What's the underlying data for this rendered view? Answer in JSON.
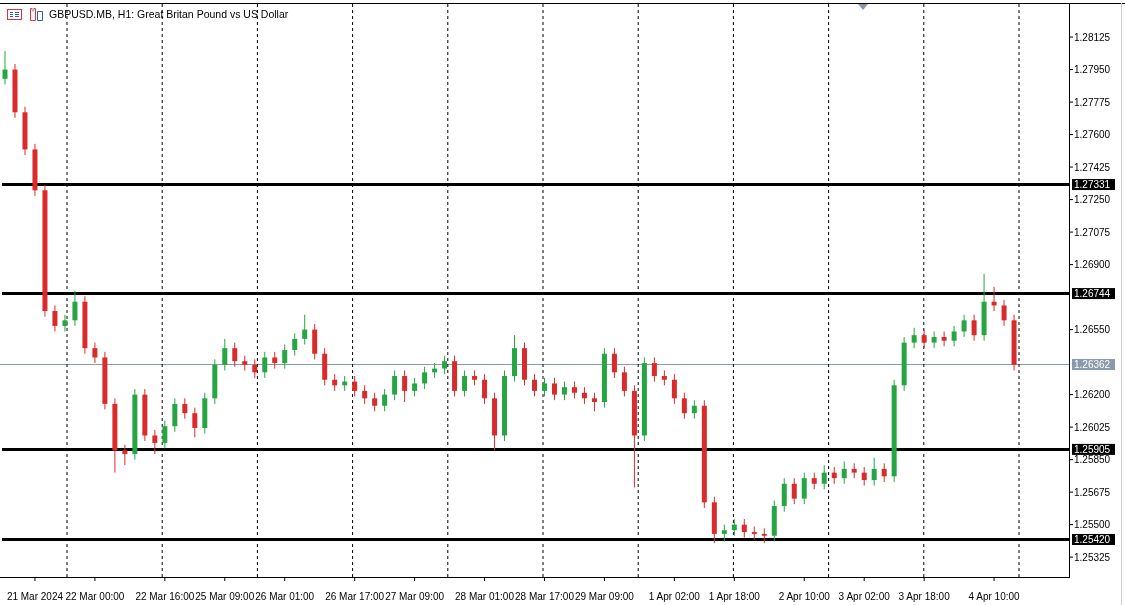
{
  "title": "GBPUSD.MB, H1:  Great Britan Pound vs US Dollar",
  "chart_data": {
    "type": "candlestick",
    "categories": [
      null,
      null,
      null,
      "21 Mar 2024",
      null,
      null,
      null,
      null,
      null,
      "22 Mar 00:00",
      null,
      null,
      null,
      null,
      null,
      null,
      "22 Mar 16:00",
      null,
      null,
      null,
      null,
      null,
      "25 Mar 09:00",
      null,
      null,
      null,
      null,
      null,
      "26 Mar 01:00",
      null,
      null,
      null,
      null,
      null,
      null,
      "26 Mar 17:00",
      null,
      null,
      null,
      null,
      null,
      "27 Mar 09:00",
      null,
      null,
      null,
      null,
      null,
      null,
      "28 Mar 01:00",
      null,
      null,
      null,
      null,
      null,
      "28 Mar 17:00",
      null,
      null,
      null,
      null,
      null,
      "29 Mar 09:00",
      null,
      null,
      null,
      null,
      null,
      null,
      "1 Apr 02:00",
      null,
      null,
      null,
      null,
      null,
      "1 Apr 18:00",
      null,
      null,
      null,
      null,
      null,
      null,
      "2 Apr 10:00",
      null,
      null,
      null,
      null,
      null,
      "3 Apr 02:00",
      null,
      null,
      null,
      null,
      null,
      "3 Apr 18:00",
      null,
      null,
      null,
      null,
      null,
      null,
      "4 Apr 10:00",
      null,
      null,
      null,
      null,
      null,
      null,
      null
    ],
    "ohlc": [
      [
        1.279,
        1.2805,
        1.2787,
        1.2795
      ],
      [
        1.2795,
        1.2798,
        1.2769,
        1.2772
      ],
      [
        1.2772,
        1.2775,
        1.2749,
        1.2752
      ],
      [
        1.2752,
        1.2755,
        1.2727,
        1.273
      ],
      [
        1.273,
        1.2733,
        1.2662,
        1.2665
      ],
      [
        1.2665,
        1.2668,
        1.2654,
        1.2657
      ],
      [
        1.2657,
        1.2663,
        1.2654,
        1.266
      ],
      [
        1.266,
        1.2676,
        1.2657,
        1.267
      ],
      [
        1.267,
        1.2673,
        1.2642,
        1.2645
      ],
      [
        1.2645,
        1.2648,
        1.2637,
        1.264
      ],
      [
        1.264,
        1.2643,
        1.2612,
        1.2615
      ],
      [
        1.2615,
        1.2618,
        1.2578,
        1.259
      ],
      [
        1.259,
        1.2593,
        1.2582,
        1.2588
      ],
      [
        1.2588,
        1.2623,
        1.2585,
        1.262
      ],
      [
        1.262,
        1.2623,
        1.2595,
        1.2598
      ],
      [
        1.2598,
        1.2601,
        1.2588,
        1.2594
      ],
      [
        1.2594,
        1.2606,
        1.2591,
        1.2603
      ],
      [
        1.2603,
        1.2618,
        1.26,
        1.2615
      ],
      [
        1.2615,
        1.2618,
        1.2607,
        1.261
      ],
      [
        1.261,
        1.2613,
        1.2597,
        1.2602
      ],
      [
        1.2602,
        1.2621,
        1.2599,
        1.2618
      ],
      [
        1.2618,
        1.2639,
        1.2615,
        1.2636
      ],
      [
        1.2636,
        1.265,
        1.2633,
        1.2645
      ],
      [
        1.2645,
        1.2648,
        1.2635,
        1.2638
      ],
      [
        1.2638,
        1.2641,
        1.2633,
        1.2636
      ],
      [
        1.2636,
        1.2639,
        1.2629,
        1.2632
      ],
      [
        1.2632,
        1.2643,
        1.2629,
        1.264
      ],
      [
        1.264,
        1.2643,
        1.2634,
        1.2637
      ],
      [
        1.2637,
        1.2647,
        1.2634,
        1.2644
      ],
      [
        1.2644,
        1.2653,
        1.2641,
        1.265
      ],
      [
        1.265,
        1.2663,
        1.2647,
        1.2655
      ],
      [
        1.2655,
        1.2658,
        1.2639,
        1.2642
      ],
      [
        1.2642,
        1.2645,
        1.2625,
        1.2628
      ],
      [
        1.2628,
        1.2631,
        1.2622,
        1.2625
      ],
      [
        1.2625,
        1.263,
        1.2622,
        1.2627
      ],
      [
        1.2627,
        1.263,
        1.2619,
        1.2622
      ],
      [
        1.2622,
        1.2625,
        1.2615,
        1.2618
      ],
      [
        1.2618,
        1.2621,
        1.2611,
        1.2614
      ],
      [
        1.2614,
        1.2623,
        1.2611,
        1.262
      ],
      [
        1.262,
        1.2633,
        1.2617,
        1.263
      ],
      [
        1.263,
        1.2633,
        1.2616,
        1.2622
      ],
      [
        1.2622,
        1.2629,
        1.2619,
        1.2626
      ],
      [
        1.2626,
        1.2635,
        1.2623,
        1.2632
      ],
      [
        1.2632,
        1.2637,
        1.2629,
        1.2634
      ],
      [
        1.2634,
        1.2641,
        1.2631,
        1.2638
      ],
      [
        1.2638,
        1.2641,
        1.2619,
        1.2622
      ],
      [
        1.2622,
        1.2633,
        1.2619,
        1.263
      ],
      [
        1.263,
        1.2633,
        1.2625,
        1.2628
      ],
      [
        1.2628,
        1.2631,
        1.2615,
        1.2618
      ],
      [
        1.2618,
        1.2621,
        1.259,
        1.2598
      ],
      [
        1.2598,
        1.2633,
        1.2595,
        1.263
      ],
      [
        1.263,
        1.2652,
        1.2627,
        1.2645
      ],
      [
        1.2645,
        1.2648,
        1.2625,
        1.2628
      ],
      [
        1.2628,
        1.2631,
        1.2619,
        1.2622
      ],
      [
        1.2622,
        1.2629,
        1.2619,
        1.2626
      ],
      [
        1.2626,
        1.2629,
        1.2617,
        1.262
      ],
      [
        1.262,
        1.2627,
        1.2617,
        1.2624
      ],
      [
        1.2624,
        1.2627,
        1.2618,
        1.2621
      ],
      [
        1.2621,
        1.2624,
        1.2615,
        1.2618
      ],
      [
        1.2618,
        1.2621,
        1.2611,
        1.2616
      ],
      [
        1.2616,
        1.2645,
        1.2613,
        1.2642
      ],
      [
        1.2642,
        1.2645,
        1.2629,
        1.2632
      ],
      [
        1.2632,
        1.2635,
        1.2619,
        1.2622
      ],
      [
        1.2622,
        1.2625,
        1.257,
        1.2598
      ],
      [
        1.2598,
        1.264,
        1.2595,
        1.2637
      ],
      [
        1.2637,
        1.264,
        1.2627,
        1.263
      ],
      [
        1.263,
        1.2633,
        1.2625,
        1.2628
      ],
      [
        1.2628,
        1.2631,
        1.2615,
        1.2618
      ],
      [
        1.2618,
        1.2621,
        1.2607,
        1.261
      ],
      [
        1.261,
        1.2617,
        1.2607,
        1.2614
      ],
      [
        1.2614,
        1.2617,
        1.2559,
        1.2562
      ],
      [
        1.2562,
        1.2565,
        1.254,
        1.2545
      ],
      [
        1.2545,
        1.255,
        1.2541,
        1.2547
      ],
      [
        1.2547,
        1.2553,
        1.2544,
        1.255
      ],
      [
        1.255,
        1.2553,
        1.2543,
        1.2546
      ],
      [
        1.2546,
        1.2549,
        1.2542,
        1.2545
      ],
      [
        1.2545,
        1.2548,
        1.254,
        1.2544
      ],
      [
        1.2544,
        1.2563,
        1.2541,
        1.256
      ],
      [
        1.256,
        1.2575,
        1.2557,
        1.2572
      ],
      [
        1.2572,
        1.2575,
        1.2561,
        1.2564
      ],
      [
        1.2564,
        1.2578,
        1.2561,
        1.2575
      ],
      [
        1.2575,
        1.2578,
        1.2569,
        1.2572
      ],
      [
        1.2572,
        1.2582,
        1.2569,
        1.2578
      ],
      [
        1.2578,
        1.2581,
        1.2572,
        1.2575
      ],
      [
        1.2575,
        1.2584,
        1.2572,
        1.258
      ],
      [
        1.258,
        1.2583,
        1.2575,
        1.2578
      ],
      [
        1.2578,
        1.2581,
        1.2571,
        1.2574
      ],
      [
        1.2574,
        1.2586,
        1.2571,
        1.258
      ],
      [
        1.258,
        1.2583,
        1.2573,
        1.2576
      ],
      [
        1.2576,
        1.2628,
        1.2573,
        1.2625
      ],
      [
        1.2625,
        1.2651,
        1.2622,
        1.2648
      ],
      [
        1.2648,
        1.2656,
        1.2645,
        1.2652
      ],
      [
        1.2652,
        1.2655,
        1.2645,
        1.2648
      ],
      [
        1.2648,
        1.2654,
        1.2645,
        1.2651
      ],
      [
        1.2651,
        1.2654,
        1.2646,
        1.2649
      ],
      [
        1.2649,
        1.2657,
        1.2646,
        1.2654
      ],
      [
        1.2654,
        1.2663,
        1.2651,
        1.266
      ],
      [
        1.266,
        1.2663,
        1.2649,
        1.2652
      ],
      [
        1.2652,
        1.2685,
        1.2649,
        1.267
      ],
      [
        1.267,
        1.2678,
        1.2665,
        1.2668
      ],
      [
        1.2668,
        1.2671,
        1.2657,
        1.266
      ],
      [
        1.266,
        1.2663,
        1.2633,
        1.2636
      ],
      null,
      null,
      null,
      null,
      null
    ],
    "ylim": [
      1.25218,
      1.28303
    ],
    "yticks": [
      {
        "value": 1.28125,
        "label": "1.28125"
      },
      {
        "value": 1.2795,
        "label": "1.27950"
      },
      {
        "value": 1.27775,
        "label": "1.27775"
      },
      {
        "value": 1.276,
        "label": "1.27600"
      },
      {
        "value": 1.27425,
        "label": "1.27425"
      },
      {
        "value": 1.2725,
        "label": "1.27250"
      },
      {
        "value": 1.27075,
        "label": "1.27075"
      },
      {
        "value": 1.269,
        "label": "1.26900"
      },
      {
        "value": 1.2655,
        "label": "1.26550"
      },
      {
        "value": 1.262,
        "label": "1.26200"
      },
      {
        "value": 1.26025,
        "label": "1.26025"
      },
      {
        "value": 1.2585,
        "label": "1.25850"
      },
      {
        "value": 1.25675,
        "label": "1.25675"
      },
      {
        "value": 1.255,
        "label": "1.25500"
      },
      {
        "value": 1.25325,
        "label": "1.25325"
      }
    ]
  },
  "levels": [
    {
      "label": "1.27331"
    },
    {
      "label": "1.26744"
    },
    {
      "label": "1.25905"
    },
    {
      "label": "1.25420"
    }
  ],
  "current_price": {
    "label": "1.26362"
  }
}
